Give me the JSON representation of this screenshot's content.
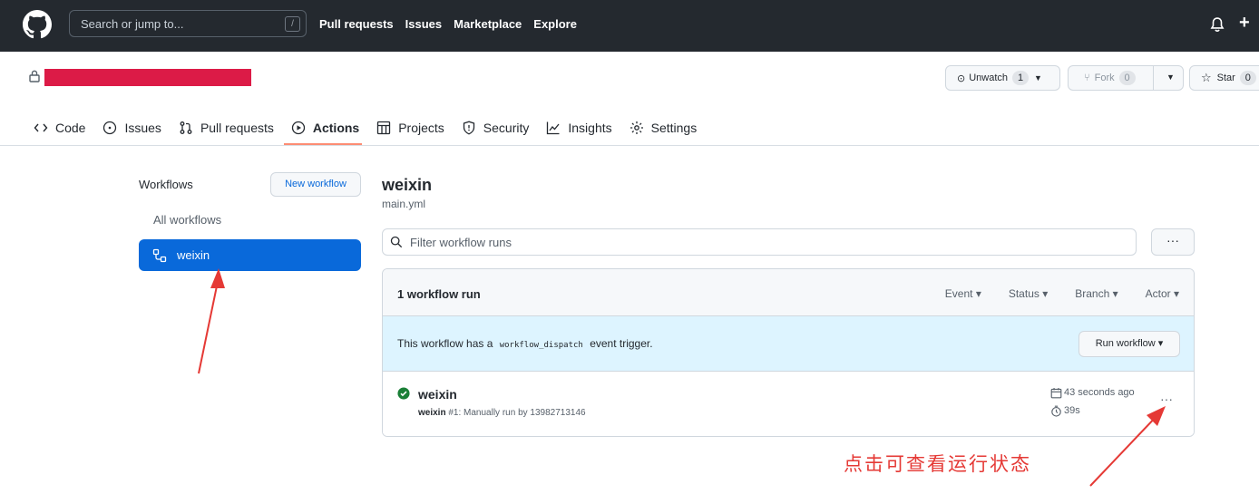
{
  "header": {
    "search_placeholder": "Search or jump to...",
    "slash_hint": "/",
    "nav": [
      "Pull requests",
      "Issues",
      "Marketplace",
      "Explore"
    ],
    "plus": "+"
  },
  "repo": {
    "unwatch": {
      "label": "Unwatch",
      "count": "1"
    },
    "fork": {
      "label": "Fork",
      "count": "0"
    },
    "star": {
      "label": "Star",
      "count": "0"
    },
    "redaction_color": "#dc1b47"
  },
  "tabs": [
    {
      "label": "Code",
      "icon": "code-icon"
    },
    {
      "label": "Issues",
      "icon": "issue-icon"
    },
    {
      "label": "Pull requests",
      "icon": "pull-request-icon"
    },
    {
      "label": "Actions",
      "icon": "play-icon",
      "active": true
    },
    {
      "label": "Projects",
      "icon": "project-icon"
    },
    {
      "label": "Security",
      "icon": "shield-icon"
    },
    {
      "label": "Insights",
      "icon": "graph-icon"
    },
    {
      "label": "Settings",
      "icon": "gear-icon"
    }
  ],
  "sidebar": {
    "title": "Workflows",
    "new_workflow": "New workflow",
    "all_workflows": "All workflows",
    "selected": "weixin"
  },
  "main": {
    "title": "weixin",
    "file": "main.yml",
    "filter_placeholder": "Filter workflow runs",
    "more": "···",
    "runs_count": "1 workflow run",
    "filters": [
      "Event ▾",
      "Status ▾",
      "Branch ▾",
      "Actor ▾"
    ],
    "dispatch_prefix": "This workflow has a",
    "dispatch_code": "workflow_dispatch",
    "dispatch_suffix": "event trigger.",
    "run_workflow": "Run workflow ▾",
    "run": {
      "title": "weixin",
      "name": "weixin",
      "meta": "#1: Manually run by 13982713146",
      "time": "43 seconds ago",
      "duration": "39s",
      "status": "success"
    }
  },
  "annotation": {
    "text": "点击可查看运行状态",
    "color": "#e53935"
  },
  "colors": {
    "header_bg": "#24292f",
    "accent_blue": "#0969da",
    "success_green": "#1a7f37",
    "active_underline": "#fd8c73",
    "dispatch_bg": "#ddf4ff"
  }
}
